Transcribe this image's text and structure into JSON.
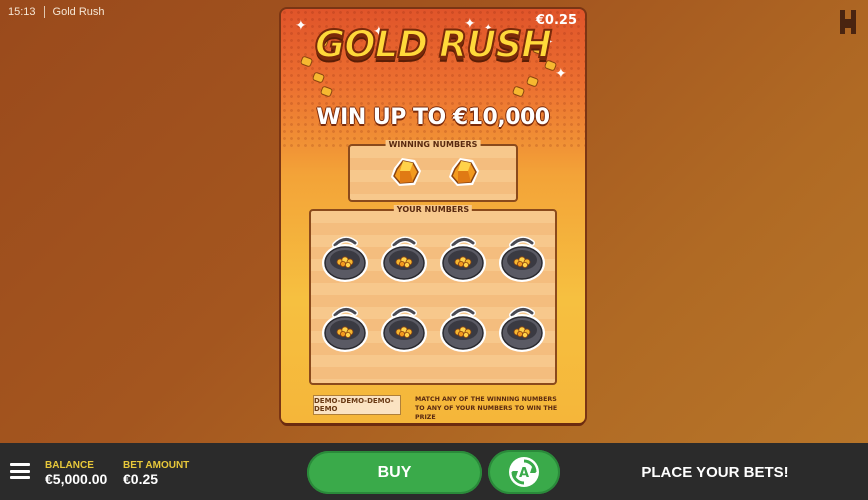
{
  "status": {
    "time": "15:13",
    "app_title": "Gold Rush"
  },
  "ticket": {
    "price": "€0.25",
    "title": "GOLD RUSH",
    "headline": "WIN UP TO €10,000",
    "winning_label": "WINNING NUMBERS",
    "your_label": "YOUR NUMBERS",
    "demo_text": "DEMO-DEMO-DEMO-DEMO",
    "instruction_line1": "MATCH ANY OF THE WINNING NUMBERS",
    "instruction_line2": "TO ANY OF YOUR NUMBERS TO WIN THE PRIZE"
  },
  "footer": {
    "balance_label": "BALANCE",
    "balance_value": "€5,000.00",
    "bet_label": "BET AMOUNT",
    "bet_value": "€0.25",
    "buy_label": "BUY",
    "place_bets": "PLACE YOUR BETS!"
  },
  "icons": {
    "menu": "hamburger-menu-icon",
    "autoplay": "autoplay-icon",
    "brand": "brand-h-logo-icon",
    "winning_symbol": "gold-nugget-icon",
    "your_symbol": "gold-pan-icon"
  },
  "colors": {
    "accent_green": "#3aaa4a",
    "gold": "#ffd93a",
    "label_yellow": "#e8c83a"
  }
}
